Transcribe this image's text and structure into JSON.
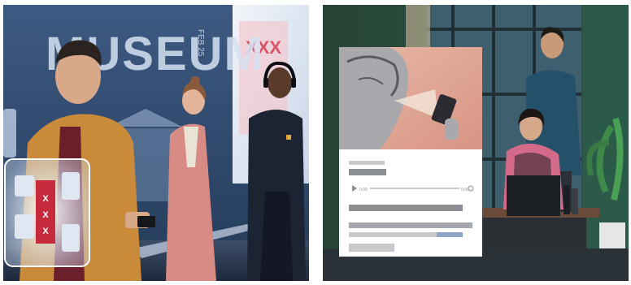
{
  "left_image": {
    "sign_word": "MUSEUM",
    "sign_vertical": "FEB 25",
    "poster_mark": "XXX",
    "palette": {
      "wall": "#2f4a6e",
      "sky_glow": "#e8eef6",
      "mustard_jacket": "#c98a3a",
      "pink_coat": "#d88a84",
      "navy_hoodie": "#1c2333"
    }
  },
  "right_image": {
    "player": {
      "time_start": "0:00",
      "time_end": "0:00"
    },
    "palette": {
      "wall": "#2c4d3e",
      "card": "#ffffff",
      "placeholder_dark": "#8c8f94",
      "placeholder_light": "#c7c9cc",
      "progress_accent": "#8ea6c8"
    }
  }
}
